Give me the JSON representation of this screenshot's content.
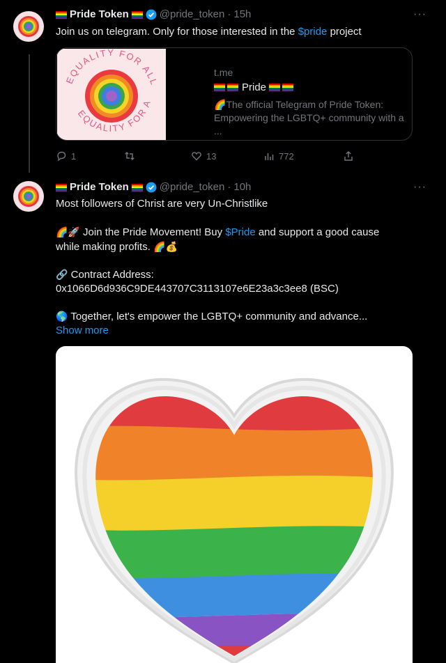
{
  "tweet1": {
    "name": "Pride Token",
    "handle": "@pride_token",
    "time": "15h",
    "text_pre": "Join us on telegram. Only for those interested in the ",
    "text_link": "$pride",
    "text_post": " project",
    "more": "···",
    "card": {
      "domain": "t.me",
      "title": "Pride",
      "desc_emoji": "🌈",
      "desc": "The official Telegram of Pride Token: Empowering the LGBTQ+ community with a ...",
      "logo_text_top": "EQUALITY FOR ALL",
      "logo_text_bottom": "EQUALITY FOR ALL"
    },
    "actions": {
      "replies": "1",
      "retweets": "",
      "likes": "13",
      "views": "772"
    }
  },
  "tweet2": {
    "name": "Pride Token",
    "handle": "@pride_token",
    "time": "10h",
    "more": "···",
    "line1": "Most followers of Christ are very Un-Christlike",
    "para2_emoji": "🌈🚀",
    "para2_a": " Join the Pride Movement! Buy ",
    "para2_link": "$Pride",
    "para2_b": " and support a good cause while making profits. ",
    "para2_tail_emoji": "🌈💰",
    "para3_emoji": "🔗",
    "para3_label": " Contract Address:",
    "para3_address": "0x1066D6d936C9DE443707C3113107e6E23a3c3ee8 (BSC)",
    "para4_emoji": "🌎",
    "para4": " Together, let's empower the LGBTQ+ community and advance... ",
    "show_more": "Show more"
  },
  "colors": {
    "background": "#000000",
    "text": "#e7e9ea",
    "muted": "#71767b",
    "link": "#1d9bf0",
    "border": "#2f3336",
    "verified": "#1d9bf0"
  }
}
